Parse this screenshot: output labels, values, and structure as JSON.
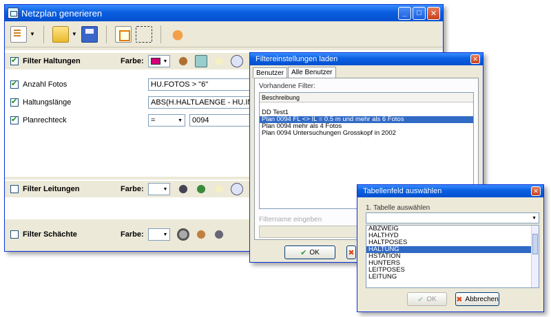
{
  "main": {
    "title": "Netzplan generieren",
    "toolbar": {
      "new_icon": "new-document-icon",
      "open_icon": "folder-open-icon",
      "save_icon": "floppy-save-icon",
      "select_icon": "select-frame-icon",
      "deselect_icon": "dashed-frame-icon",
      "hand_icon": "hand-pointer-icon"
    },
    "haltungen": {
      "label": "Filter Haltungen",
      "farbe_label": "Farbe:",
      "color": "#d1007a",
      "rows": [
        {
          "label": "Anzahl Fotos",
          "value": "HU.FOTOS > \"6\""
        },
        {
          "label": "Haltungslänge",
          "value": "ABS(H.HALTLAENGE - HU.INSPL"
        },
        {
          "label": "Planrechteck",
          "operator": "=",
          "value": "0094"
        }
      ]
    },
    "leitungen": {
      "label": "Filter Leitungen",
      "farbe_label": "Farbe:"
    },
    "schaechte": {
      "label": "Filter Schächte",
      "farbe_label": "Farbe:"
    }
  },
  "filter_dialog": {
    "title": "Filtereinstellungen laden",
    "tabs": [
      "Benutzer",
      "Alle Benutzer"
    ],
    "list_label": "Vorhandene Filter:",
    "column_header": "Beschreibung",
    "items": [
      "DD Test1",
      "Plan 0094 FL <> IL = 0.5 m und mehr als 6 Fotos",
      "Plan 0094 mehr als 4 Fotos",
      "Plan 0094 Untersuchungen Grosskopf in 2002"
    ],
    "selected_index": 1,
    "name_label": "Filtername eingeben",
    "name_value": "",
    "ok_label": "OK"
  },
  "field_dialog": {
    "title": "Tabellenfeld auswählen",
    "step_label": "1. Tabelle auswählen",
    "combo_value": "",
    "items": [
      "ABZWEIG",
      "HALTHYD",
      "HALTPOSES",
      "HALTUNG",
      "HSTATION",
      "HUNTERS",
      "LEITPOSES",
      "LEITUNG"
    ],
    "selected_index": 3,
    "ok_label": "OK",
    "cancel_label": "Abbrechen"
  }
}
